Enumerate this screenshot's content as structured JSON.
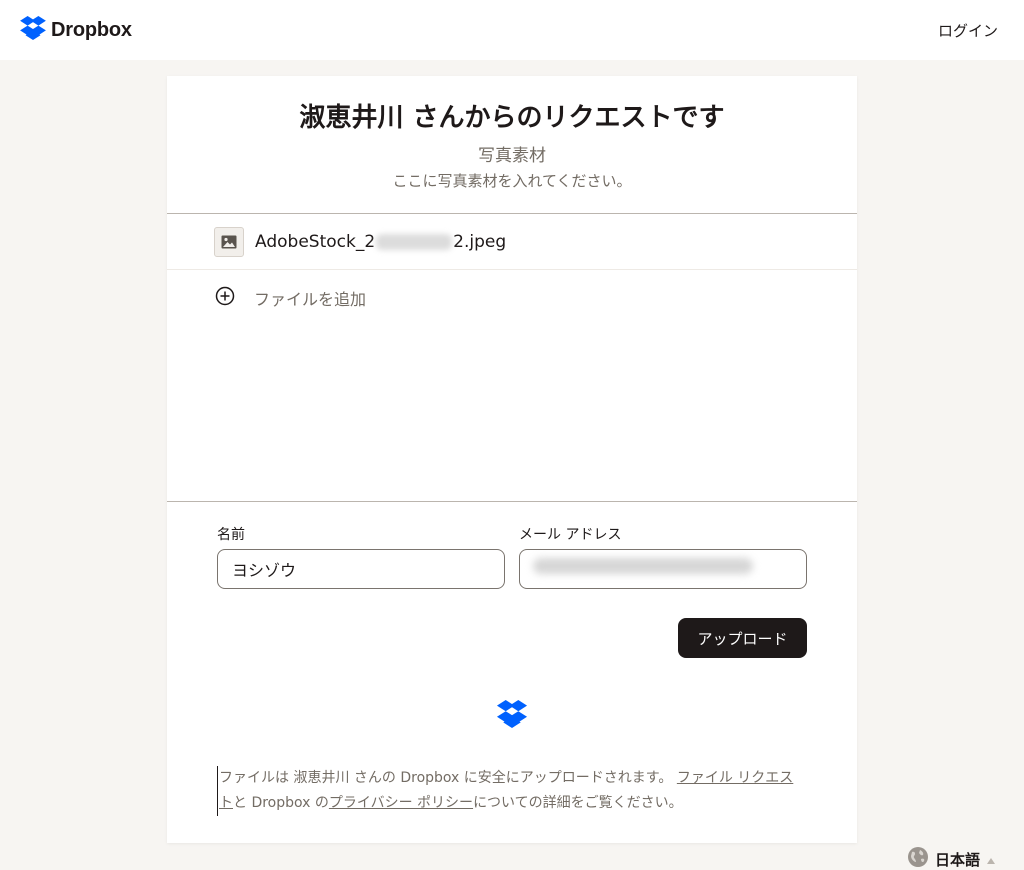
{
  "header": {
    "brand": "Dropbox",
    "login": "ログイン"
  },
  "request": {
    "title": "淑恵井川 さんからのリクエストです",
    "subtitle": "写真素材",
    "description": "ここに写真素材を入れてください。"
  },
  "files": {
    "items": [
      {
        "name_prefix": "AdobeStock_2",
        "name_suffix": "2.jpeg",
        "icon": "image-icon"
      }
    ],
    "add_label": "ファイルを追加"
  },
  "form": {
    "name_label": "名前",
    "name_value": "ヨシゾウ",
    "email_label": "メール アドレス",
    "upload_label": "アップロード"
  },
  "legal": {
    "part1": "ファイルは 淑恵井川 さんの Dropbox に安全にアップロードされます。",
    "link1": "ファイル リクエスト",
    "part2": "と Dropbox の",
    "link2": "プライバシー ポリシー",
    "part3": "についての詳細をご覧ください。"
  },
  "language": {
    "label": "日本語",
    "icon": "globe-icon"
  },
  "colors": {
    "brand_blue": "#0061fe",
    "button_dark": "#1e1919",
    "muted_text": "#736c64",
    "page_bg": "#f7f5f2"
  }
}
